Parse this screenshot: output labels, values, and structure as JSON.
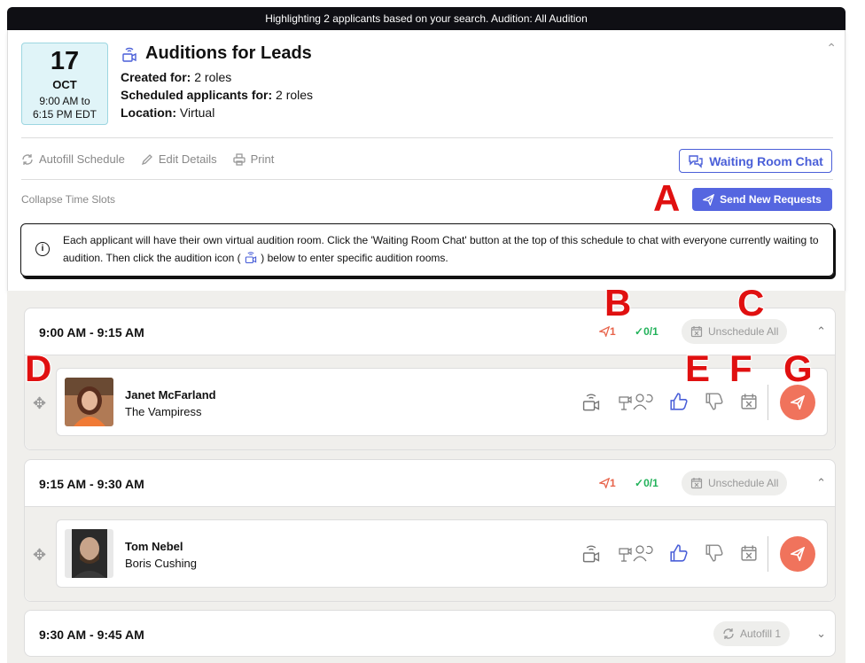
{
  "banner": "Highlighting 2 applicants based on your search. Audition: All Audition",
  "event": {
    "day": "17",
    "month": "OCT",
    "time_line1": "9:00 AM to",
    "time_line2": "6:15 PM EDT",
    "title": "Auditions for Leads",
    "created_label": "Created for:",
    "created_value": "2 roles",
    "scheduled_label": "Scheduled applicants for:",
    "scheduled_value": "2 roles",
    "location_label": "Location:",
    "location_value": "Virtual"
  },
  "toolbar": {
    "autofill": "Autofill Schedule",
    "edit": "Edit Details",
    "print": "Print",
    "waiting_room": "Waiting Room Chat",
    "collapse_slots": "Collapse Time Slots",
    "send_requests": "Send New Requests"
  },
  "notice": {
    "part1": "Each applicant will have their own virtual audition room. Click the 'Waiting Room Chat' button at the top of this schedule to chat with everyone currently waiting to audition. Then click the audition icon (",
    "part2": ") below to enter specific audition rooms."
  },
  "slots": [
    {
      "time": "9:00 AM - 9:15 AM",
      "sent": "1",
      "confirmed": "0/1",
      "action": "Unschedule All",
      "applicant": {
        "name": "Janet McFarland",
        "role": "The Vampiress"
      }
    },
    {
      "time": "9:15 AM - 9:30 AM",
      "sent": "1",
      "confirmed": "0/1",
      "action": "Unschedule All",
      "applicant": {
        "name": "Tom Nebel",
        "role": "Boris Cushing"
      }
    },
    {
      "time": "9:30 AM - 9:45 AM",
      "action": "Autofill 1"
    }
  ],
  "markers": [
    "A",
    "B",
    "C",
    "D",
    "E",
    "F",
    "G"
  ],
  "colors": {
    "accent": "#5566e0",
    "send": "#f0735c",
    "sent_stat": "#e8634a",
    "ok_stat": "#22b25a",
    "marker": "#e01010"
  }
}
